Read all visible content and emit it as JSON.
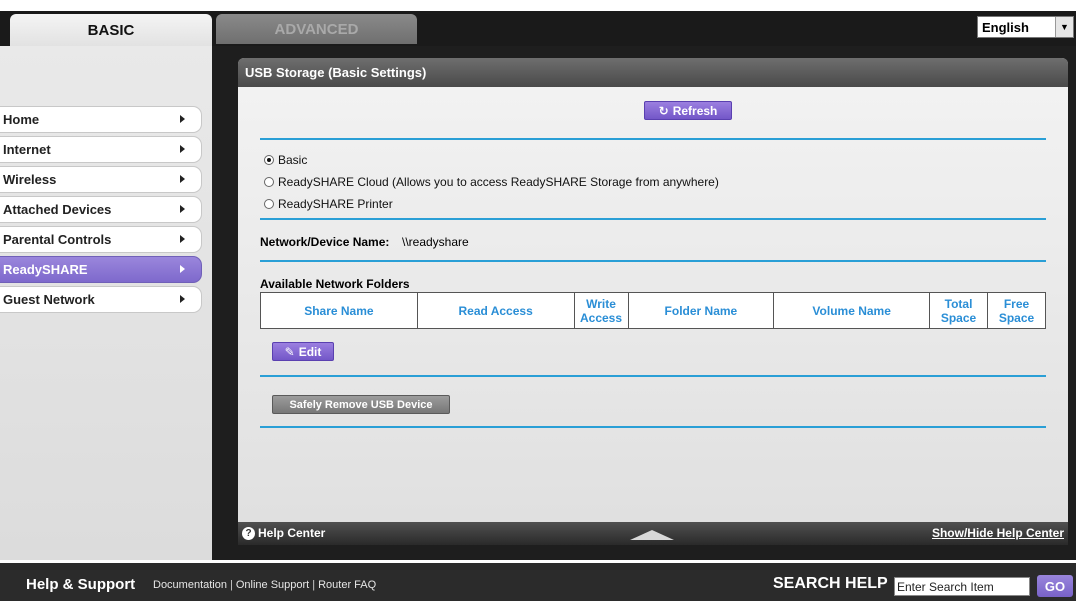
{
  "tabs": {
    "basic": "BASIC",
    "advanced": "ADVANCED"
  },
  "language": {
    "selected": "English"
  },
  "sidebar": {
    "items": [
      {
        "label": "Home"
      },
      {
        "label": "Internet"
      },
      {
        "label": "Wireless"
      },
      {
        "label": "Attached Devices"
      },
      {
        "label": "Parental Controls"
      },
      {
        "label": "ReadySHARE",
        "active": true
      },
      {
        "label": "Guest Network"
      }
    ]
  },
  "content": {
    "title": "USB Storage (Basic Settings)",
    "refresh_label": "Refresh",
    "options": [
      {
        "label": "Basic",
        "selected": true
      },
      {
        "label": "ReadySHARE Cloud (Allows you to access ReadySHARE Storage from anywhere)",
        "selected": false
      },
      {
        "label": "ReadySHARE Printer",
        "selected": false
      }
    ],
    "device_name_label": "Network/Device Name:",
    "device_name_value": "\\\\readyshare",
    "folders_title": "Available Network Folders",
    "table_headers": [
      "Share Name",
      "Read Access",
      "Write Access",
      "Folder Name",
      "Volume Name",
      "Total Space",
      "Free Space"
    ],
    "edit_label": "Edit",
    "remove_usb_label": "Safely Remove USB Device"
  },
  "help_center": {
    "label": "Help Center",
    "toggle_label": "Show/Hide Help Center"
  },
  "footer": {
    "title": "Help & Support",
    "links": [
      "Documentation",
      "Online Support",
      "Router FAQ"
    ],
    "search_label": "SEARCH HELP",
    "search_value": "Enter Search Item",
    "go_label": "GO"
  },
  "colors": {
    "accent": "#7e69cc",
    "divider": "#2a9fd6",
    "table_header_text": "#2a8ed6"
  }
}
